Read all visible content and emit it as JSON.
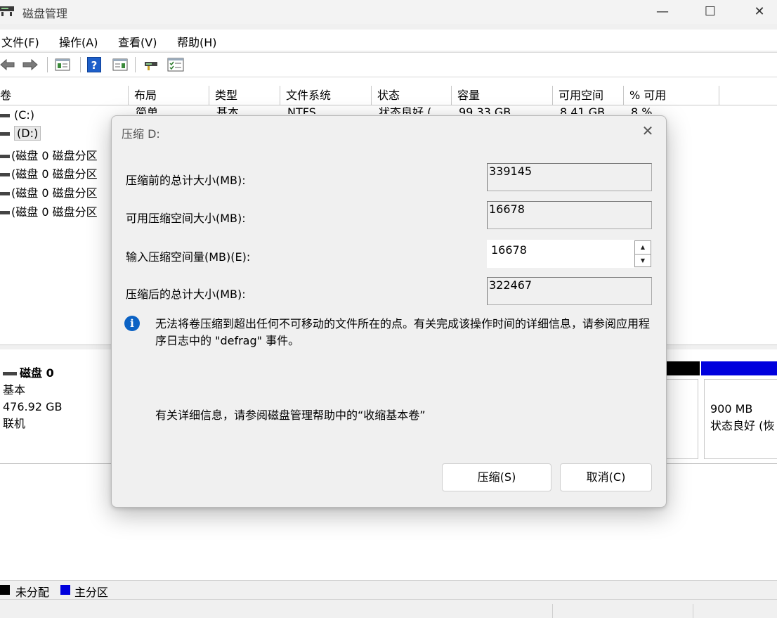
{
  "window": {
    "title": "磁盘管理",
    "controls": {
      "minimize": "—",
      "maximize": "☐",
      "close": "✕"
    }
  },
  "menu": [
    "文件(F)",
    "操作(A)",
    "查看(V)",
    "帮助(H)"
  ],
  "toolbar": {
    "icons": [
      "back-arrow-icon",
      "forward-arrow-icon",
      "console-tree-icon",
      "help-icon",
      "action-pane-icon",
      "connect-icon",
      "properties-icon"
    ],
    "help_glyph": "?"
  },
  "volume_list": {
    "columns": [
      "卷",
      "布局",
      "类型",
      "文件系统",
      "状态",
      "容量",
      "可用空间",
      "% 可用"
    ],
    "rows": [
      "(C:)",
      "(D:)",
      "(磁盘 0 磁盘分区",
      "(磁盘 0 磁盘分区",
      "(磁盘 0 磁盘分区",
      "(磁盘 0 磁盘分区"
    ],
    "partial_row": [
      "简单",
      "基本",
      "NTFS",
      "状态良好 (",
      "99.33 GB",
      "8.41 GB",
      "8 %"
    ]
  },
  "disk": {
    "name": "磁盘 0",
    "type": "基本",
    "size": "476.92 GB",
    "status": "联机",
    "partition_size": "900 MB",
    "partition_status": "状态良好 (恢"
  },
  "legend": [
    "未分配",
    "主分区"
  ],
  "colors": {
    "unallocated": "#000000",
    "primary": "#0000dd",
    "info": "#0b62c4"
  },
  "dialog": {
    "title": "压缩 D:",
    "close": "✕",
    "fields": {
      "total_before_label": "压缩前的总计大小(MB):",
      "total_before_value": "339145",
      "available_label": "可用压缩空间大小(MB):",
      "available_value": "16678",
      "input_label": "输入压缩空间量(MB)(E):",
      "input_value": "16678",
      "total_after_label": "压缩后的总计大小(MB):",
      "total_after_value": "322467"
    },
    "info_glyph": "i",
    "info_text": "无法将卷压缩到超出任何不可移动的文件所在的点。有关完成该操作时间的详细信息，请参阅应用程序日志中的 \"defrag\" 事件。",
    "help_text": "有关详细信息，请参阅磁盘管理帮助中的“收缩基本卷”",
    "buttons": {
      "shrink": "压缩(S)",
      "cancel": "取消(C)"
    }
  }
}
